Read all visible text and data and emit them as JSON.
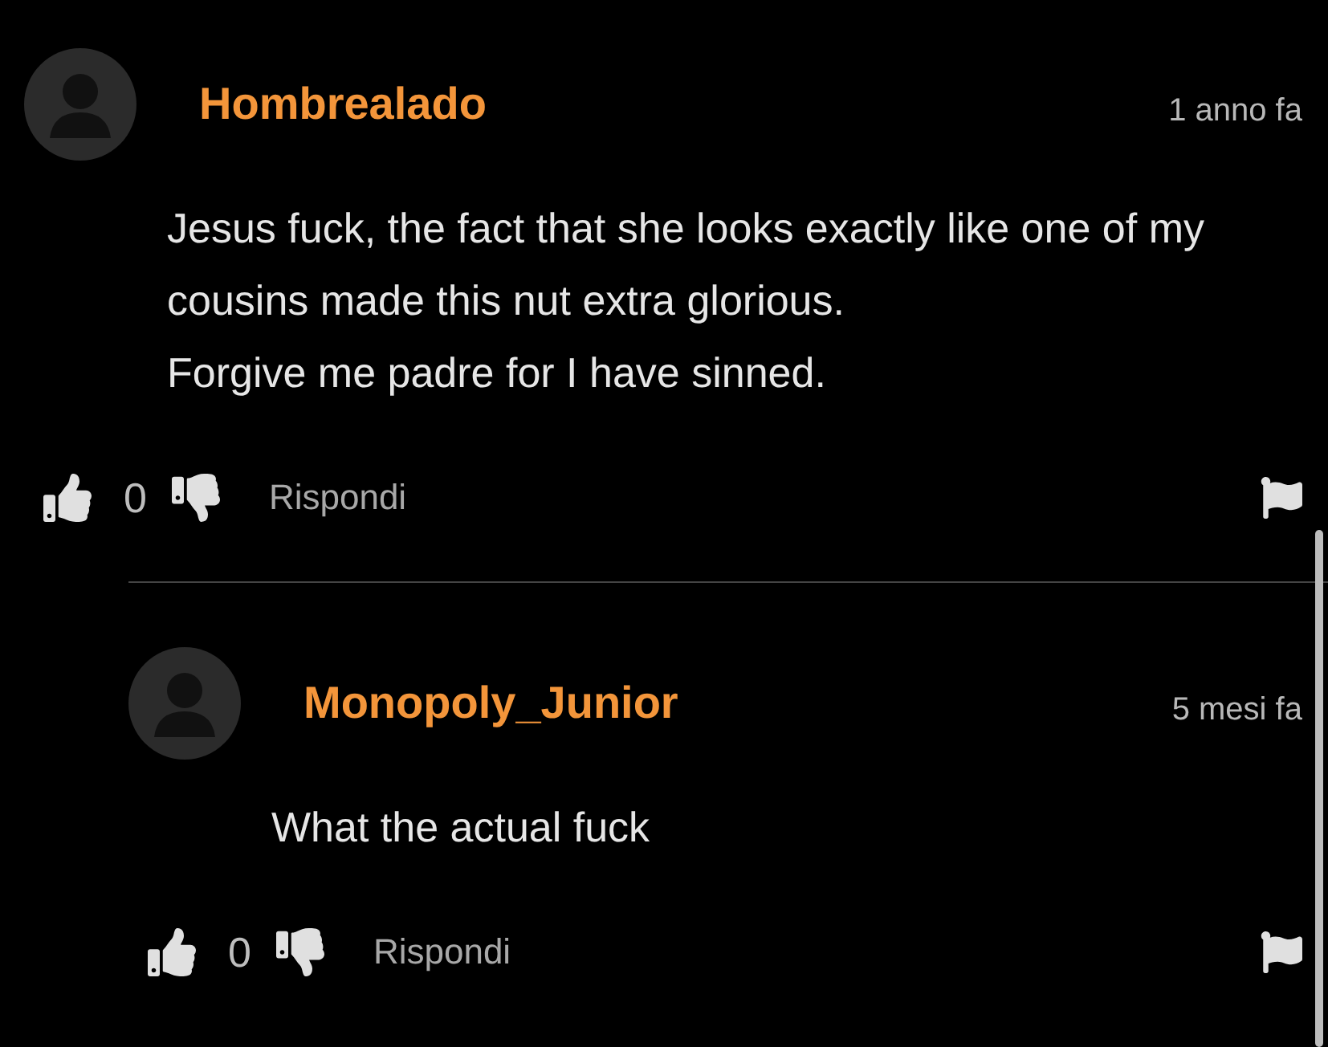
{
  "comments": [
    {
      "author": "Hombrealado",
      "time": "1 anno fa",
      "paragraphs": [
        "Jesus fuck, the fact that she looks exactly like one of my cousins made this nut extra glorious.",
        "Forgive me padre for I have sinned."
      ],
      "likes": "0",
      "reply_label": "Rispondi",
      "replies": [
        {
          "author": "Monopoly_Junior",
          "time": "5 mesi fa",
          "paragraphs": [
            "What the actual fuck"
          ],
          "likes": "0",
          "reply_label": "Rispondi"
        }
      ]
    }
  ]
}
